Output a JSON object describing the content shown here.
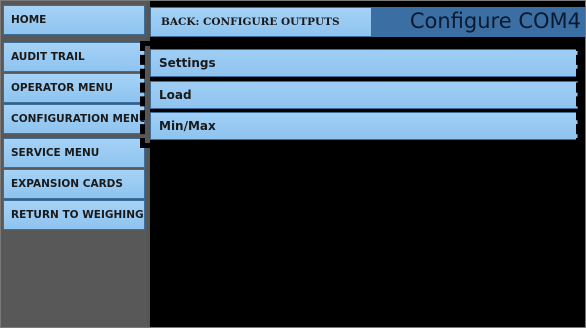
{
  "sidebar": {
    "items": [
      {
        "label": "HOME"
      },
      {
        "label": "AUDIT TRAIL"
      },
      {
        "label": "OPERATOR MENU"
      },
      {
        "label": "CONFIGURATION MENU"
      },
      {
        "label": "SERVICE MENU"
      },
      {
        "label": "EXPANSION CARDS"
      },
      {
        "label": "RETURN TO WEIGHING"
      }
    ]
  },
  "header": {
    "back_label": "BACK: CONFIGURE OUTPUTS",
    "title": "Configure COM4"
  },
  "menu": {
    "items": [
      {
        "label": "Settings"
      },
      {
        "label": "Load"
      },
      {
        "label": "Min/Max"
      }
    ]
  },
  "colors": {
    "button_fill": "#8ec4ef",
    "header_bar": "#3b6ea3",
    "main_background": "#000000",
    "sidebar_background": "#585858"
  }
}
